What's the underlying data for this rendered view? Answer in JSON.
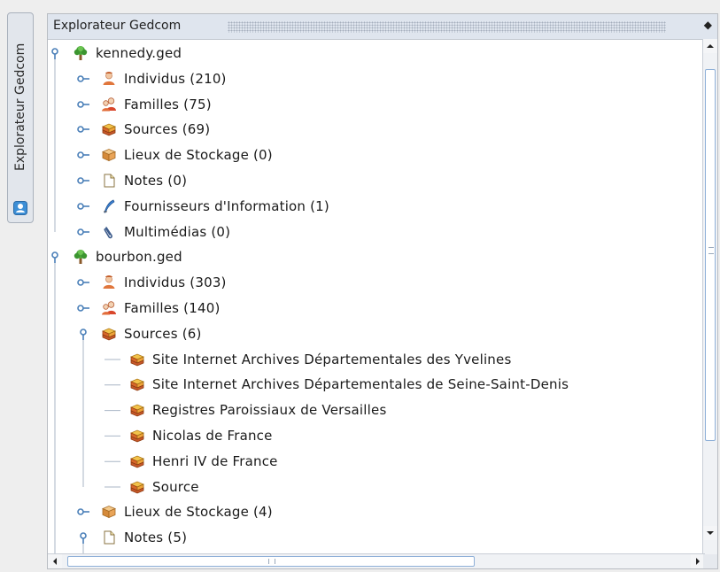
{
  "side_tab": {
    "label": "Explorateur Gedcom",
    "icon": "user-icon"
  },
  "panel": {
    "title": "Explorateur Gedcom",
    "menu_glyph": "◆"
  },
  "tree": [
    {
      "level": 0,
      "label": "kennedy.ged",
      "icon": "tree-icon",
      "expanded": true
    },
    {
      "level": 1,
      "label": "Individus (210)",
      "icon": "person-icon",
      "expanded": false
    },
    {
      "level": 1,
      "label": "Familles (75)",
      "icon": "family-icon",
      "expanded": false
    },
    {
      "level": 1,
      "label": "Sources (69)",
      "icon": "book-icon",
      "expanded": false
    },
    {
      "level": 1,
      "label": "Lieux de Stockage (0)",
      "icon": "box-icon",
      "expanded": false
    },
    {
      "level": 1,
      "label": "Notes (0)",
      "icon": "note-icon",
      "expanded": false
    },
    {
      "level": 1,
      "label": "Fournisseurs d'Information (1)",
      "icon": "quill-icon",
      "expanded": false
    },
    {
      "level": 1,
      "label": "Multimédias (0)",
      "icon": "paperclip-icon",
      "expanded": false
    },
    {
      "level": 0,
      "label": "bourbon.ged",
      "icon": "tree-icon",
      "expanded": true
    },
    {
      "level": 1,
      "label": "Individus (303)",
      "icon": "person-icon",
      "expanded": false
    },
    {
      "level": 1,
      "label": "Familles (140)",
      "icon": "family-icon",
      "expanded": false
    },
    {
      "level": 1,
      "label": "Sources (6)",
      "icon": "book-icon",
      "expanded": true
    },
    {
      "level": 2,
      "label": "Site Internet Archives Départementales des Yvelines",
      "icon": "book-icon"
    },
    {
      "level": 2,
      "label": "Site Internet Archives Départementales de Seine-Saint-Denis",
      "icon": "book-icon"
    },
    {
      "level": 2,
      "label": "Registres Paroissiaux de Versailles",
      "icon": "book-icon"
    },
    {
      "level": 2,
      "label": "Nicolas de France",
      "icon": "book-icon"
    },
    {
      "level": 2,
      "label": "Henri IV de France",
      "icon": "book-icon"
    },
    {
      "level": 2,
      "label": "Source",
      "icon": "book-icon"
    },
    {
      "level": 1,
      "label": "Lieux de Stockage (4)",
      "icon": "box-icon",
      "expanded": false
    },
    {
      "level": 1,
      "label": "Notes (5)",
      "icon": "note-icon",
      "expanded": true
    }
  ],
  "colors": {
    "tree_line": "#a9b6c6",
    "handle": "#4a7fb8",
    "scroll_thumb_border": "#8fb0d8",
    "title_bar": "#dfe5ee"
  }
}
